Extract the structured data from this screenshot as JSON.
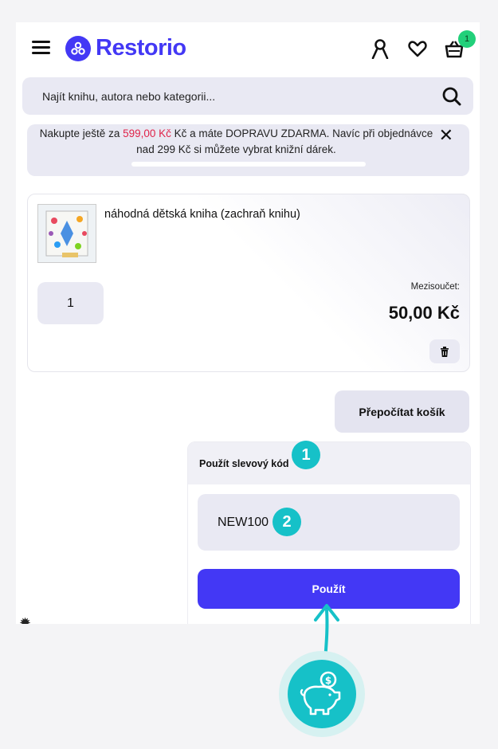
{
  "header": {
    "logo_text": "Restorio",
    "cart_count": "1",
    "icons": [
      "menu-icon",
      "user-icon",
      "heart-icon",
      "basket-icon"
    ]
  },
  "search": {
    "placeholder": "Najít knihu, autora nebo kategorii..."
  },
  "banner": {
    "text_before": "Nakupte ještě za ",
    "amount": "599,00 Kč",
    "text_after": " Kč a máte DOPRAVU ZDARMA. Navíc při objednávce",
    "line2": "nad 299 Kč si můžete vybrat knižní dárek.",
    "progress": 0
  },
  "cart_item": {
    "name": "náhodná dětská kniha (zachraň knihu)",
    "quantity": "1",
    "subtotal_label": "Mezisoučet:",
    "subtotal_value": "50,00 Kč"
  },
  "recalc_label": "Přepočítat košík",
  "discount": {
    "title": "Použít slevový kód",
    "code": "NEW100",
    "apply_label": "Použít"
  },
  "steps": [
    "1",
    "2"
  ],
  "colors": {
    "brand": "#4338f5",
    "accent": "#16c1c8",
    "badge": "#22d07a",
    "price_red": "#e0244a"
  }
}
